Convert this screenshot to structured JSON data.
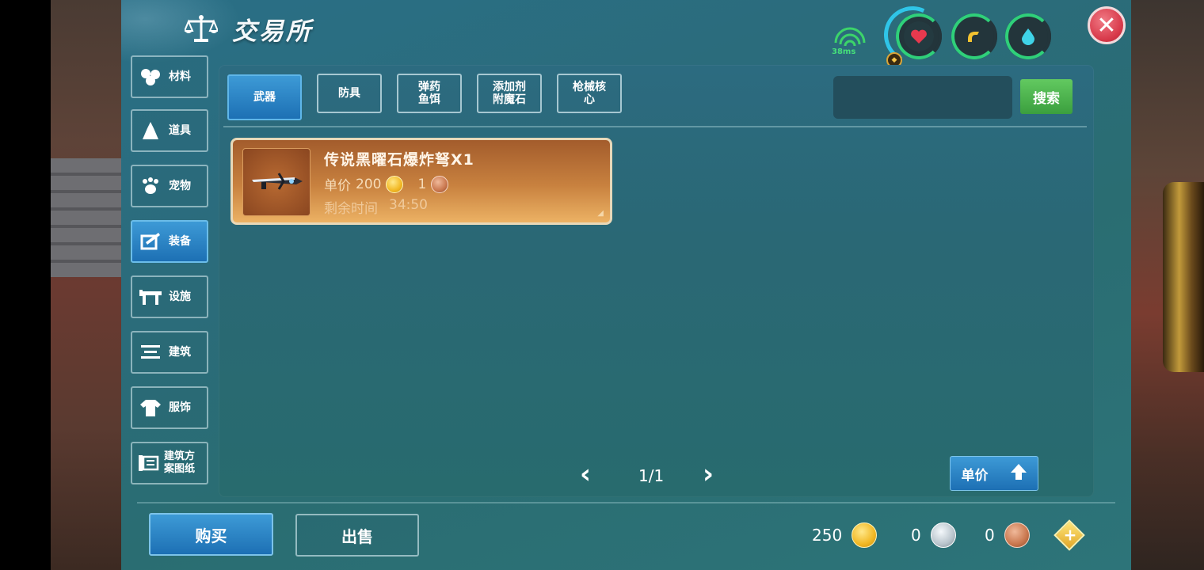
{
  "window": {
    "title": "交易所"
  },
  "status": {
    "ping": "38ms",
    "stats": [
      {
        "name": "health",
        "icon": "heart-icon",
        "color": "#e8394e"
      },
      {
        "name": "hunger",
        "icon": "drumstick-icon",
        "color": "#f2c230"
      },
      {
        "name": "water",
        "icon": "water-drop-icon",
        "color": "#3fd3e8"
      }
    ]
  },
  "sidebar": {
    "items": [
      {
        "label": "材料",
        "icon": "materials-icon",
        "active": false
      },
      {
        "label": "道具",
        "icon": "tool-icon",
        "active": false
      },
      {
        "label": "宠物",
        "icon": "paw-icon",
        "active": false
      },
      {
        "label": "装备",
        "icon": "equipment-icon",
        "active": true
      },
      {
        "label": "设施",
        "icon": "facility-icon",
        "active": false
      },
      {
        "label": "建筑",
        "icon": "building-icon",
        "active": false
      },
      {
        "label": "服饰",
        "icon": "clothing-icon",
        "active": false
      },
      {
        "label": "建筑方\n案图纸",
        "icon": "blueprint-icon",
        "active": false
      }
    ]
  },
  "tabs": [
    {
      "label": "武器",
      "active": true
    },
    {
      "label": "防具",
      "active": false
    },
    {
      "label": "弹药\n鱼饵",
      "active": false
    },
    {
      "label": "添加剂\n附魔石",
      "active": false
    },
    {
      "label": "枪械核\n心",
      "active": false
    }
  ],
  "search": {
    "value": "",
    "button_label": "搜索"
  },
  "listings": [
    {
      "name": "传说黑曜石爆炸弩X1",
      "price_label": "单价",
      "price_gold": "200",
      "price_bronze": "1",
      "time_label": "剩余时间",
      "time_remaining": "34:50",
      "icon": "crossbow-icon"
    }
  ],
  "pager": {
    "text": "1/1"
  },
  "sort": {
    "label": "单价"
  },
  "actions": {
    "buy_label": "购买",
    "sell_label": "出售"
  },
  "currency": {
    "gold": "250",
    "silver": "0",
    "bronze": "0"
  }
}
